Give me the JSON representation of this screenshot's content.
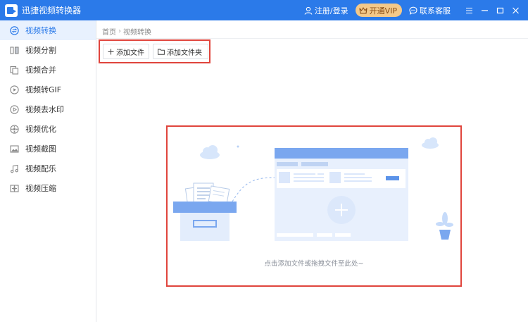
{
  "app": {
    "title": "迅捷视频转换器"
  },
  "titlebar": {
    "login_label": "注册/登录",
    "vip_label": "开通VIP",
    "service_label": "联系客服",
    "icons": [
      "user-icon",
      "crown-icon",
      "chat-icon",
      "menu-icon",
      "minimize-icon",
      "maximize-icon",
      "close-icon"
    ]
  },
  "sidebar": {
    "items": [
      {
        "label": "视频转换",
        "icon": "convert-icon",
        "active": true
      },
      {
        "label": "视频分割",
        "icon": "split-icon"
      },
      {
        "label": "视频合并",
        "icon": "merge-icon"
      },
      {
        "label": "视频转GIF",
        "icon": "gif-icon"
      },
      {
        "label": "视频去水印",
        "icon": "watermark-icon"
      },
      {
        "label": "视频优化",
        "icon": "optimize-icon"
      },
      {
        "label": "视频截图",
        "icon": "screenshot-icon"
      },
      {
        "label": "视频配乐",
        "icon": "music-icon"
      },
      {
        "label": "视频压缩",
        "icon": "compress-icon"
      }
    ]
  },
  "breadcrumb": {
    "home": "首页",
    "current": "视频转换"
  },
  "toolbar": {
    "add_file_label": "添加文件",
    "add_folder_label": "添加文件夹"
  },
  "dropzone": {
    "hint": "点击添加文件或拖拽文件至此处~"
  },
  "colors": {
    "brand": "#2b7ae9",
    "vip": "#f4c98a",
    "highlight": "#e0453d",
    "active_bg": "#e8f1fe"
  }
}
